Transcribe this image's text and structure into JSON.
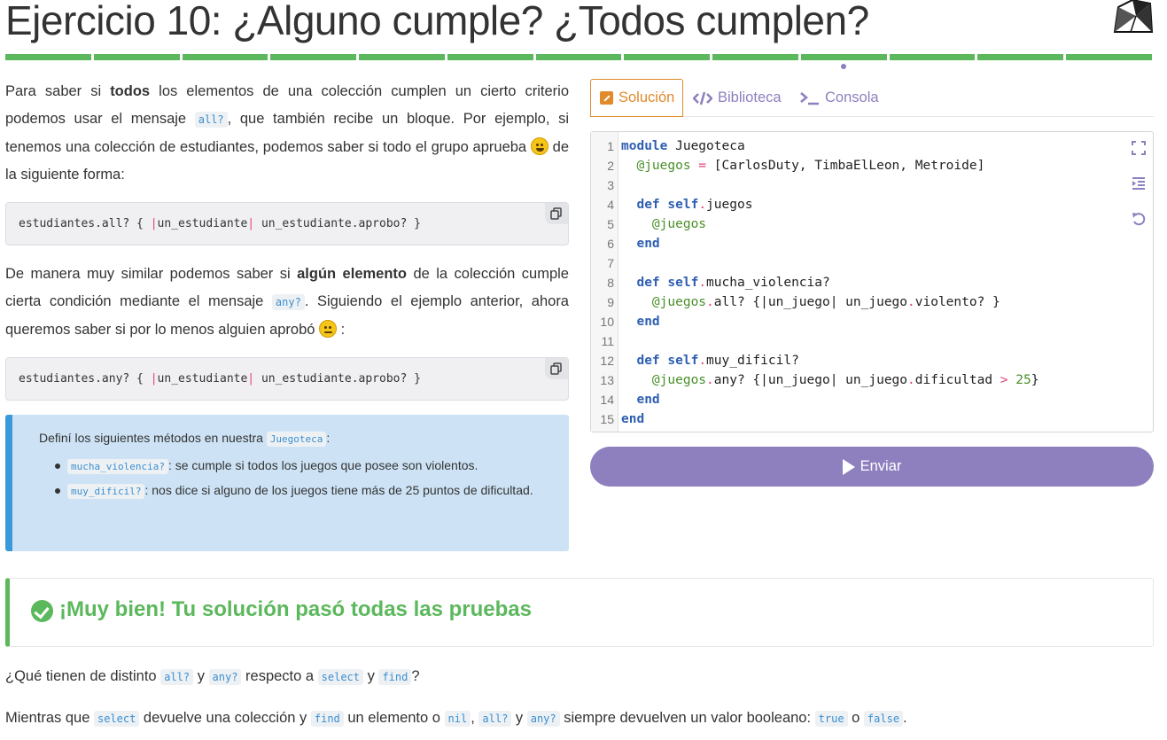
{
  "header": {
    "title": "Ejercicio 10: ¿Alguno cumple? ¿Todos cumplen?",
    "logo_icon": "ruby-gem-icon",
    "progress_segments": 13,
    "progress_color": "#5cb85c"
  },
  "explanation": {
    "p1_a": "Para saber si ",
    "p1_bold": "todos",
    "p1_b": " los elementos de una colección cumplen un cierto criterio podemos usar el mensaje ",
    "p1_code": "all?",
    "p1_c": ", que también recibe un bloque. Por ejemplo, si tenemos una colección de estudiantes, podemos saber si todo el grupo aprueba ",
    "p1_d": " de la siguiente forma:",
    "code1_a": "estudiantes.all? { ",
    "code1_bar1": "|",
    "code1_b": "un_estudiante",
    "code1_bar2": "|",
    "code1_c": " un_estudiante.aprobo? }",
    "p2_a": "De manera muy similar podemos saber si ",
    "p2_bold": "algún elemento",
    "p2_b": " de la colección cumple cierta condición mediante el mensaje ",
    "p2_code": "any?",
    "p2_c": ". Siguiendo el ejemplo anterior, ahora queremos saber si por lo menos alguien aprobó ",
    "p2_d": " :",
    "code2_a": "estudiantes.any? { ",
    "code2_bar1": "|",
    "code2_b": "un_estudiante",
    "code2_bar2": "|",
    "code2_c": " un_estudiante.aprobo? }"
  },
  "task": {
    "intro_a": "Definí los siguientes métodos en nuestra ",
    "intro_code": "Juegoteca",
    "intro_b": ":",
    "item1_code": "mucha_violencia?",
    "item1_text": ": se cumple si todos los juegos que posee son violentos.",
    "item2_code": "muy_dificil?",
    "item2_text": ": nos dice si alguno de los juegos tiene más de 25 puntos de dificultad."
  },
  "tabs": {
    "solution": "Solución",
    "library": "Biblioteca",
    "console": "Consola"
  },
  "editor": {
    "line_numbers": [
      "1",
      "2",
      "3",
      "4",
      "5",
      "6",
      "7",
      "8",
      "9",
      "10",
      "11",
      "12",
      "13",
      "14",
      "15"
    ],
    "l1_kw": "module",
    "l1_rest": " Juegoteca",
    "l2_iv": "  @juegos",
    "l2_op": " =",
    "l2_rest": " [CarlosDuty, TimbaElLeon, Metroide]",
    "l4_kw1": "  def",
    "l4_kw2": " self",
    "l4_op": ".",
    "l4_rest": "juegos",
    "l5_iv": "    @juegos",
    "l6_kw": "  end",
    "l8_kw1": "  def",
    "l8_kw2": " self",
    "l8_op": ".",
    "l8_rest": "mucha_violencia?",
    "l9_iv": "    @juegos",
    "l9_op1": ".",
    "l9_a": "all? {|un_juego| un_juego",
    "l9_op2": ".",
    "l9_b": "violento? }",
    "l10_kw": "  end",
    "l12_kw1": "  def",
    "l12_kw2": " self",
    "l12_op": ".",
    "l12_rest": "muy_dificil?",
    "l13_iv": "    @juegos",
    "l13_op1": ".",
    "l13_a": "any? {|un_juego| un_juego",
    "l13_op2": ".",
    "l13_b": "dificultad ",
    "l13_op3": ">",
    "l13_num": " 25",
    "l13_c": "}",
    "l14_kw": "  end",
    "l15_kw": "end"
  },
  "submit": {
    "label": "Enviar"
  },
  "result": {
    "message": "¡Muy bien! Tu solución pasó todas las pruebas"
  },
  "followup": {
    "q_a": "¿Qué tienen de distinto ",
    "q_c1": "all?",
    "q_b": " y ",
    "q_c2": "any?",
    "q_d": " respecto a ",
    "q_c3": "select",
    "q_e": " y ",
    "q_c4": "find",
    "q_f": "?",
    "a_a": "Mientras que ",
    "a_c1": "select",
    "a_b": " devuelve una colección y ",
    "a_c2": "find",
    "a_c": " un elemento o ",
    "a_c3": "nil",
    "a_d": ", ",
    "a_c4": "all?",
    "a_e": " y ",
    "a_c5": "any?",
    "a_f": " siempre devuelven un valor booleano: ",
    "a_c6": "true",
    "a_g": " o ",
    "a_c7": "false",
    "a_h": "."
  }
}
